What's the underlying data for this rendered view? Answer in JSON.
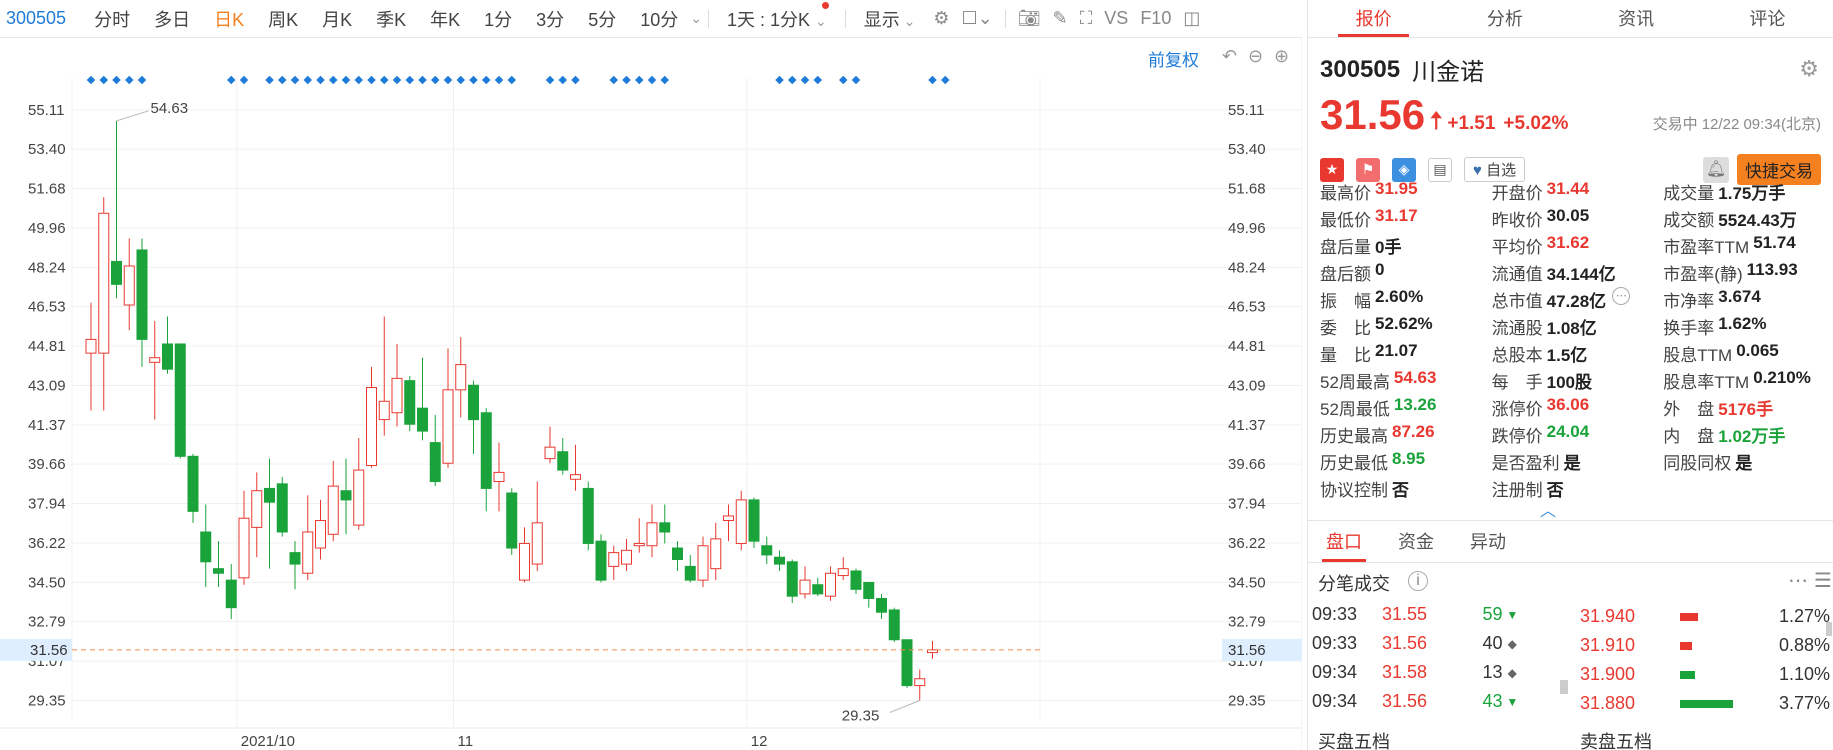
{
  "toolbar": {
    "code": "300505",
    "tabs": [
      "分时",
      "多日",
      "日K",
      "周K",
      "月K",
      "季K",
      "年K",
      "1分",
      "3分",
      "5分",
      "10分"
    ],
    "active_tab": "日K",
    "period_select": "1天 : 1分K",
    "display_label": "显示",
    "right_icons": [
      "VS",
      "F10"
    ]
  },
  "chart_controls": {
    "adjust_label": "前复权"
  },
  "chart_data": {
    "type": "candlestick",
    "y_ticks": [
      "55.11",
      "53.40",
      "51.68",
      "49.96",
      "48.24",
      "46.53",
      "44.81",
      "43.09",
      "41.37",
      "39.66",
      "37.94",
      "36.22",
      "34.50",
      "32.79",
      "31.07",
      "29.35"
    ],
    "ylim": [
      28.5,
      56.5
    ],
    "x_labels": [
      {
        "label": "2021/10",
        "index": 13
      },
      {
        "label": "11",
        "index": 30
      },
      {
        "label": "12",
        "index": 53
      }
    ],
    "current_price": 31.56,
    "high_label": "54.63",
    "low_label": "29.35",
    "candles": [
      {
        "o": 44.5,
        "c": 45.1,
        "h": 46.7,
        "l": 42.0
      },
      {
        "o": 44.5,
        "c": 50.6,
        "h": 51.3,
        "l": 42.0
      },
      {
        "o": 48.5,
        "c": 47.5,
        "h": 54.63,
        "l": 46.9
      },
      {
        "o": 46.6,
        "c": 48.3,
        "h": 49.5,
        "l": 45.5
      },
      {
        "o": 49.0,
        "c": 45.1,
        "h": 49.5,
        "l": 43.9
      },
      {
        "o": 44.1,
        "c": 44.3,
        "h": 45.9,
        "l": 41.6
      },
      {
        "o": 44.9,
        "c": 43.8,
        "h": 46.1,
        "l": 43.6
      },
      {
        "o": 44.9,
        "c": 40.0,
        "h": 44.9,
        "l": 39.9
      },
      {
        "o": 40.0,
        "c": 37.6,
        "h": 40.1,
        "l": 37.1
      },
      {
        "o": 36.7,
        "c": 35.4,
        "h": 37.9,
        "l": 34.3
      },
      {
        "o": 35.1,
        "c": 34.9,
        "h": 36.3,
        "l": 34.3
      },
      {
        "o": 34.6,
        "c": 33.4,
        "h": 35.3,
        "l": 32.9
      },
      {
        "o": 34.7,
        "c": 37.3,
        "h": 38.5,
        "l": 34.4
      },
      {
        "o": 36.9,
        "c": 38.5,
        "h": 39.3,
        "l": 35.6
      },
      {
        "o": 38.6,
        "c": 38.0,
        "h": 39.9,
        "l": 35.1
      },
      {
        "o": 38.8,
        "c": 36.7,
        "h": 39.1,
        "l": 36.5
      },
      {
        "o": 35.8,
        "c": 35.3,
        "h": 36.3,
        "l": 34.2
      },
      {
        "o": 34.9,
        "c": 36.7,
        "h": 38.3,
        "l": 34.6
      },
      {
        "o": 36.0,
        "c": 37.2,
        "h": 38.1,
        "l": 35.5
      },
      {
        "o": 36.6,
        "c": 38.7,
        "h": 39.8,
        "l": 36.3
      },
      {
        "o": 38.5,
        "c": 38.1,
        "h": 39.9,
        "l": 36.6
      },
      {
        "o": 37.0,
        "c": 39.4,
        "h": 40.8,
        "l": 36.8
      },
      {
        "o": 39.6,
        "c": 43.0,
        "h": 43.9,
        "l": 39.5
      },
      {
        "o": 41.6,
        "c": 42.4,
        "h": 46.1,
        "l": 40.9
      },
      {
        "o": 41.9,
        "c": 43.4,
        "h": 44.9,
        "l": 41.3
      },
      {
        "o": 43.3,
        "c": 41.4,
        "h": 43.5,
        "l": 41.1
      },
      {
        "o": 42.1,
        "c": 41.1,
        "h": 44.3,
        "l": 40.7
      },
      {
        "o": 40.6,
        "c": 38.9,
        "h": 41.8,
        "l": 38.7
      },
      {
        "o": 39.7,
        "c": 42.9,
        "h": 44.7,
        "l": 39.5
      },
      {
        "o": 42.9,
        "c": 44.0,
        "h": 45.2,
        "l": 41.7
      },
      {
        "o": 43.1,
        "c": 41.6,
        "h": 43.3,
        "l": 40.1
      },
      {
        "o": 41.9,
        "c": 38.6,
        "h": 42.1,
        "l": 37.6
      },
      {
        "o": 38.9,
        "c": 39.3,
        "h": 40.6,
        "l": 37.6
      },
      {
        "o": 38.4,
        "c": 36.0,
        "h": 38.6,
        "l": 35.7
      },
      {
        "o": 34.6,
        "c": 36.2,
        "h": 36.9,
        "l": 34.5
      },
      {
        "o": 35.3,
        "c": 37.1,
        "h": 38.9,
        "l": 35.0
      },
      {
        "o": 39.9,
        "c": 40.4,
        "h": 41.3,
        "l": 39.7
      },
      {
        "o": 40.2,
        "c": 39.4,
        "h": 40.8,
        "l": 39.2
      },
      {
        "o": 39.0,
        "c": 39.2,
        "h": 40.5,
        "l": 38.5
      },
      {
        "o": 38.6,
        "c": 36.2,
        "h": 38.9,
        "l": 35.9
      },
      {
        "o": 36.3,
        "c": 34.6,
        "h": 36.6,
        "l": 34.5
      },
      {
        "o": 35.2,
        "c": 35.8,
        "h": 36.1,
        "l": 34.6
      },
      {
        "o": 35.3,
        "c": 35.9,
        "h": 36.4,
        "l": 35.0
      },
      {
        "o": 36.1,
        "c": 36.2,
        "h": 37.3,
        "l": 35.8
      },
      {
        "o": 36.1,
        "c": 37.1,
        "h": 37.9,
        "l": 35.6
      },
      {
        "o": 37.1,
        "c": 36.7,
        "h": 37.9,
        "l": 36.2
      },
      {
        "o": 36.0,
        "c": 35.5,
        "h": 36.3,
        "l": 35.0
      },
      {
        "o": 35.2,
        "c": 34.6,
        "h": 35.7,
        "l": 34.5
      },
      {
        "o": 34.6,
        "c": 36.1,
        "h": 36.5,
        "l": 34.3
      },
      {
        "o": 35.1,
        "c": 36.4,
        "h": 37.1,
        "l": 34.6
      },
      {
        "o": 37.2,
        "c": 37.4,
        "h": 37.9,
        "l": 36.3
      },
      {
        "o": 36.2,
        "c": 38.1,
        "h": 38.5,
        "l": 35.9
      },
      {
        "o": 38.1,
        "c": 36.3,
        "h": 38.2,
        "l": 36.0
      },
      {
        "o": 36.1,
        "c": 35.7,
        "h": 36.5,
        "l": 35.3
      },
      {
        "o": 35.6,
        "c": 35.3,
        "h": 35.9,
        "l": 35.0
      },
      {
        "o": 35.4,
        "c": 33.9,
        "h": 35.5,
        "l": 33.6
      },
      {
        "o": 34.0,
        "c": 34.6,
        "h": 35.2,
        "l": 33.8
      },
      {
        "o": 34.4,
        "c": 34.0,
        "h": 34.7,
        "l": 33.9
      },
      {
        "o": 33.9,
        "c": 34.9,
        "h": 35.2,
        "l": 33.7
      },
      {
        "o": 34.8,
        "c": 35.1,
        "h": 35.6,
        "l": 34.6
      },
      {
        "o": 35.0,
        "c": 34.2,
        "h": 35.1,
        "l": 34.0
      },
      {
        "o": 34.5,
        "c": 33.8,
        "h": 34.5,
        "l": 33.4
      },
      {
        "o": 33.8,
        "c": 33.2,
        "h": 34.0,
        "l": 32.9
      },
      {
        "o": 33.3,
        "c": 32.0,
        "h": 33.4,
        "l": 31.9
      },
      {
        "o": 32.0,
        "c": 30.0,
        "h": 32.0,
        "l": 29.9
      },
      {
        "o": 30.0,
        "c": 30.3,
        "h": 30.7,
        "l": 29.35
      },
      {
        "o": 31.44,
        "c": 31.56,
        "h": 31.95,
        "l": 31.17
      }
    ],
    "markers": [
      0,
      1,
      2,
      3,
      4,
      11,
      12,
      14,
      15,
      16,
      17,
      18,
      19,
      20,
      21,
      22,
      23,
      24,
      25,
      26,
      27,
      28,
      29,
      30,
      31,
      32,
      33,
      36,
      37,
      38,
      41,
      42,
      43,
      44,
      45,
      54,
      55,
      56,
      57,
      59,
      60,
      66,
      67
    ]
  },
  "stock": {
    "code": "300505",
    "name": "川金诺",
    "price": "31.56",
    "change": "+1.51",
    "change_pct": "+5.02%",
    "status": "交易中 12/22 09:34(北京)",
    "watch_label": "自选",
    "trade_label": "快捷交易"
  },
  "right_tabs": [
    "报价",
    "分析",
    "资讯",
    "评论"
  ],
  "stats": [
    [
      {
        "l": "最高价",
        "v": "31.95",
        "c": "red"
      },
      {
        "l": "开盘价",
        "v": "31.44",
        "c": "red"
      },
      {
        "l": "成交量",
        "v": "1.75万手",
        "c": ""
      }
    ],
    [
      {
        "l": "最低价",
        "v": "31.17",
        "c": "red"
      },
      {
        "l": "昨收价",
        "v": "30.05",
        "c": ""
      },
      {
        "l": "成交额",
        "v": "5524.43万",
        "c": ""
      }
    ],
    [
      {
        "l": "盘后量",
        "v": "0手",
        "c": ""
      },
      {
        "l": "平均价",
        "v": "31.62",
        "c": "red"
      },
      {
        "l": "市盈率TTM",
        "v": "51.74",
        "c": ""
      }
    ],
    [
      {
        "l": "盘后额",
        "v": "0",
        "c": ""
      },
      {
        "l": "流通值",
        "v": "34.144亿",
        "c": ""
      },
      {
        "l": "市盈率(静)",
        "v": "113.93",
        "c": ""
      }
    ],
    [
      {
        "l": "振　幅",
        "v": "2.60%",
        "c": ""
      },
      {
        "l": "总市值",
        "v": "47.28亿",
        "c": ""
      },
      {
        "l": "市净率",
        "v": "3.674",
        "c": ""
      }
    ],
    [
      {
        "l": "委　比",
        "v": "52.62%",
        "c": ""
      },
      {
        "l": "流通股",
        "v": "1.08亿",
        "c": ""
      },
      {
        "l": "换手率",
        "v": "1.62%",
        "c": ""
      }
    ],
    [
      {
        "l": "量　比",
        "v": "21.07",
        "c": ""
      },
      {
        "l": "总股本",
        "v": "1.5亿",
        "c": ""
      },
      {
        "l": "股息TTM",
        "v": "0.065",
        "c": ""
      }
    ],
    [
      {
        "l": "52周最高",
        "v": "54.63",
        "c": "red"
      },
      {
        "l": "每　手",
        "v": "100股",
        "c": ""
      },
      {
        "l": "股息率TTM",
        "v": "0.210%",
        "c": ""
      }
    ],
    [
      {
        "l": "52周最低",
        "v": "13.26",
        "c": "green"
      },
      {
        "l": "涨停价",
        "v": "36.06",
        "c": "red"
      },
      {
        "l": "外　盘",
        "v": "5176手",
        "c": "red"
      }
    ],
    [
      {
        "l": "历史最高",
        "v": "87.26",
        "c": "red"
      },
      {
        "l": "跌停价",
        "v": "24.04",
        "c": "green"
      },
      {
        "l": "内　盘",
        "v": "1.02万手",
        "c": "green"
      }
    ],
    [
      {
        "l": "历史最低",
        "v": "8.95",
        "c": "green"
      },
      {
        "l": "是否盈利",
        "v": "是",
        "c": ""
      },
      {
        "l": "同股同权",
        "v": "是",
        "c": ""
      }
    ],
    [
      {
        "l": "协议控制",
        "v": "否",
        "c": ""
      },
      {
        "l": "注册制",
        "v": "否",
        "c": ""
      },
      {
        "l": "",
        "v": "",
        "c": ""
      }
    ]
  ],
  "sub_tabs": [
    "盘口",
    "资金",
    "异动"
  ],
  "ticks_title": "分笔成交",
  "ticks": [
    {
      "t": "09:33",
      "p": "31.55",
      "v": "59",
      "d": "down"
    },
    {
      "t": "09:33",
      "p": "31.56",
      "v": "40",
      "d": "flat"
    },
    {
      "t": "09:34",
      "p": "31.58",
      "v": "13",
      "d": "flat"
    },
    {
      "t": "09:34",
      "p": "31.56",
      "v": "43",
      "d": "down"
    }
  ],
  "depth": [
    {
      "p": "31.940",
      "pct": "1.27%",
      "col": "#e8382f"
    },
    {
      "p": "31.910",
      "pct": "0.88%",
      "col": "#e8382f"
    },
    {
      "p": "31.900",
      "pct": "1.10%",
      "col": "#1aa33a"
    },
    {
      "p": "31.880",
      "pct": "3.77%",
      "col": "#1aa33a"
    }
  ],
  "bottom_labels": [
    "买盘五档",
    "卖盘五档"
  ],
  "colors": {
    "up": "#e8382f",
    "down": "#1aa33a",
    "accent": "#1e7bd8",
    "brand": "#f5801f"
  }
}
